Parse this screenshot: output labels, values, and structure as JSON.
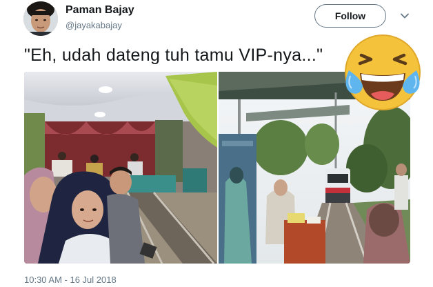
{
  "user": {
    "display_name": "Paman Bajay",
    "handle": "@jayakabajay"
  },
  "follow_label": "Follow",
  "tweet_text": "\"Eh, udah dateng tuh tamu VIP-nya...\"",
  "timestamp": "10:30 AM - 16 Jul 2018",
  "icons": {
    "more": "chevron-down-icon",
    "reaction": "tears-of-joy-emoji"
  },
  "colors": {
    "text": "#14171a",
    "secondary": "#657786",
    "emoji": "#f5c33b"
  }
}
